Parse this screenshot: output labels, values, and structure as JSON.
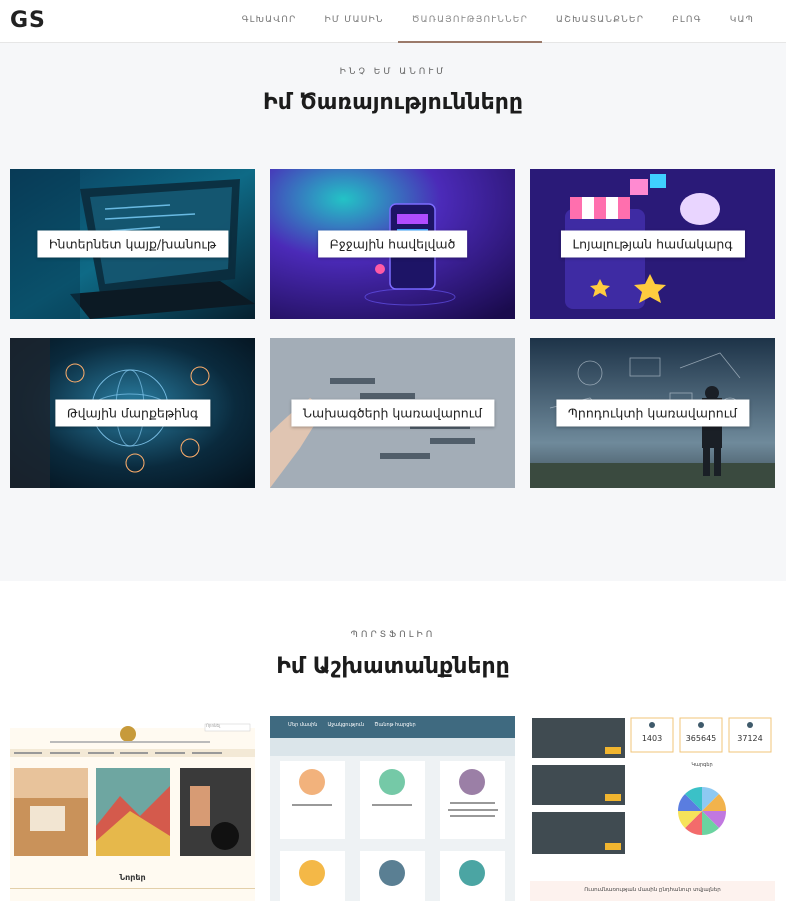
{
  "header": {
    "logo": "GS",
    "nav": [
      "ԳԼԽԱՎՈՐ",
      "ԻՄ ՄԱՍԻՆ",
      "ԾԱՌԱՅՈՒԹՅՈՒՆՆԵՐ",
      "ԱՇԽԱՏԱՆՔՆԵՐ",
      "ԲԼՈԳ",
      "ԿԱՊ"
    ],
    "active_index": 2
  },
  "services": {
    "eyebrow": "ԻՆՉ ԵՄ ԱՆՈՒՄ",
    "title": "Իմ Ծառայությունները",
    "cards": [
      {
        "label": "Ինտերնետ կայք/խանութ",
        "icon": "laptop-code-image"
      },
      {
        "label": "Բջջային հավելված",
        "icon": "mobile-app-image"
      },
      {
        "label": "Լոյալության համակարգ",
        "icon": "loyalty-shop-image"
      },
      {
        "label": "Թվային մարքեթինգ",
        "icon": "digital-globe-image"
      },
      {
        "label": "Նախագծերի կառավարում",
        "icon": "project-chart-image"
      },
      {
        "label": "Պրոդուկտի կառավարում",
        "icon": "product-sketch-image"
      }
    ]
  },
  "portfolio": {
    "eyebrow": "ՊՈՐՏՖՈԼԻՈ",
    "title": "Իմ Աշխատանքները",
    "thumb1": {
      "search_placeholder": "Որոնել",
      "section": "Նորեր"
    },
    "thumb2": {
      "nav": [
        "Մեր մասին",
        "Աջակցություն",
        "Ծանոթ հարցեր"
      ]
    },
    "thumb3": {
      "stats": [
        "1403",
        "365645",
        "37124"
      ],
      "chart_title": "Կարգեր",
      "footer": "Ուսումնառության մասին ընդհանուր տվյալներ"
    }
  },
  "colors": {
    "accent": "#9b7a6a",
    "section_bg": "#f6f7f9"
  }
}
